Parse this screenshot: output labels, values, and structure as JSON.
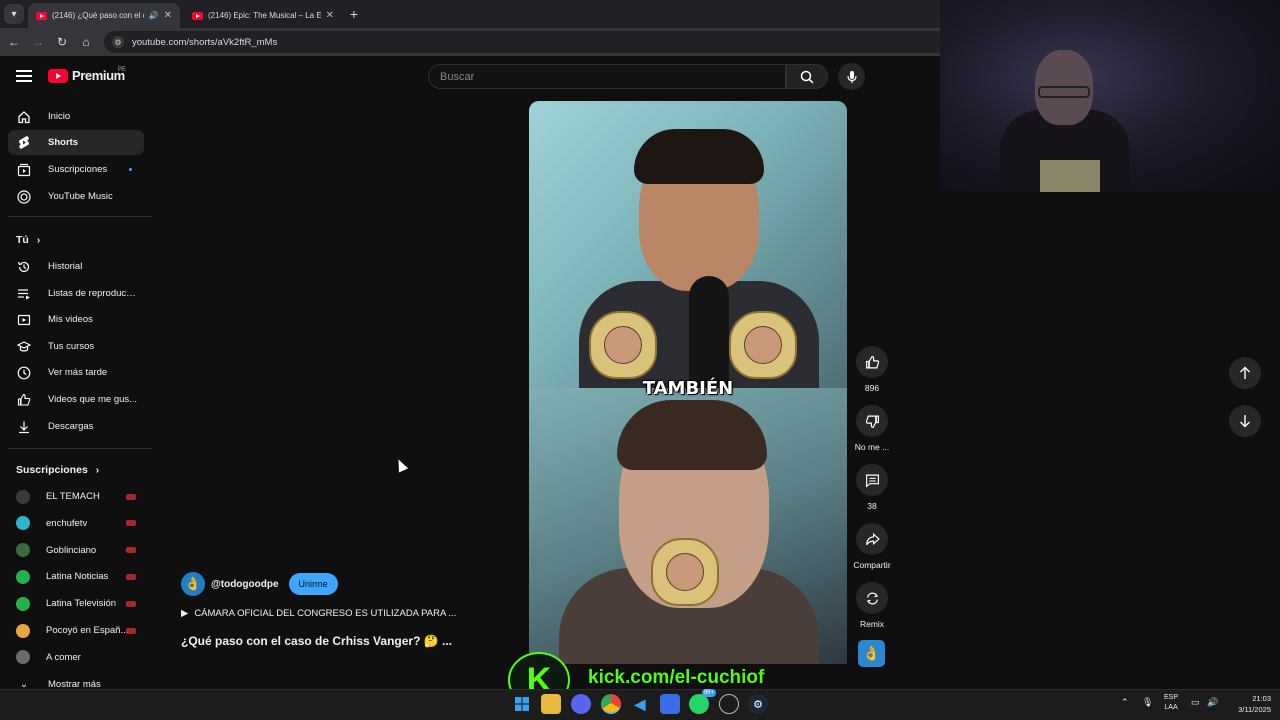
{
  "browser": {
    "tabs": [
      {
        "title": "(2146) ¿Qué paso con el ca",
        "active": true
      },
      {
        "title": "(2146) Epic: The Musical – La E",
        "active": false
      }
    ],
    "url": "youtube.com/shorts/aVk2ftR_mMs"
  },
  "masthead": {
    "logo_text": "Premium",
    "region": "PE",
    "search_placeholder": "Buscar"
  },
  "sidebar": {
    "main": [
      {
        "label": "Inicio",
        "icon": "home-icon"
      },
      {
        "label": "Shorts",
        "icon": "shorts-icon",
        "active": true
      },
      {
        "label": "Suscripciones",
        "icon": "subscriptions-icon"
      },
      {
        "label": "YouTube Music",
        "icon": "music-icon"
      }
    ],
    "you_heading": "Tú",
    "you": [
      {
        "label": "Historial",
        "icon": "history-icon"
      },
      {
        "label": "Listas de reproducc...",
        "icon": "playlists-icon"
      },
      {
        "label": "Mis videos",
        "icon": "my-videos-icon"
      },
      {
        "label": "Tus cursos",
        "icon": "courses-icon"
      },
      {
        "label": "Ver más tarde",
        "icon": "watch-later-icon"
      },
      {
        "label": "Videos que me gus...",
        "icon": "liked-icon"
      },
      {
        "label": "Descargas",
        "icon": "downloads-icon"
      }
    ],
    "subs_heading": "Suscripciones",
    "subs": [
      {
        "label": "EL TEMACH",
        "color": "#3a3a3a"
      },
      {
        "label": "enchufetv",
        "color": "#2fb5c9"
      },
      {
        "label": "Goblinciano",
        "color": "#3c6b3c"
      },
      {
        "label": "Latina Noticias",
        "color": "#22b14c"
      },
      {
        "label": "Latina Televisión",
        "color": "#22b14c"
      },
      {
        "label": "Pocoyó en Españ...",
        "color": "#e8a640"
      },
      {
        "label": "A comer",
        "color": "#6a6a6a"
      }
    ],
    "show_more": "Mostrar más"
  },
  "short": {
    "caption": "TAMBIÉN",
    "likes": "896",
    "dislike_label": "No me ...",
    "comments": "38",
    "share_label": "Compartir",
    "remix_label": "Remix",
    "channel_handle": "@todogoodpe",
    "join_label": "Unirme",
    "playlist_text": "CÁMARA OFICIAL DEL CONGRESO ES UTILIZADA PARA ...",
    "title": "¿Qué paso con el caso de Crhiss Vanger? 🤔 ..."
  },
  "overlay": {
    "kick_letter": "K",
    "kick_url": "kick.com/el-cuchiof"
  },
  "taskbar": {
    "lang": "ESP",
    "lang_sub": "LAA",
    "time": "21:03",
    "date": "3/11/2025",
    "badge_discord": "",
    "badge_whatsapp": "99+"
  },
  "colors": {
    "accent": "#ff0033",
    "join": "#3ea6ff",
    "kick": "#53fc18"
  }
}
